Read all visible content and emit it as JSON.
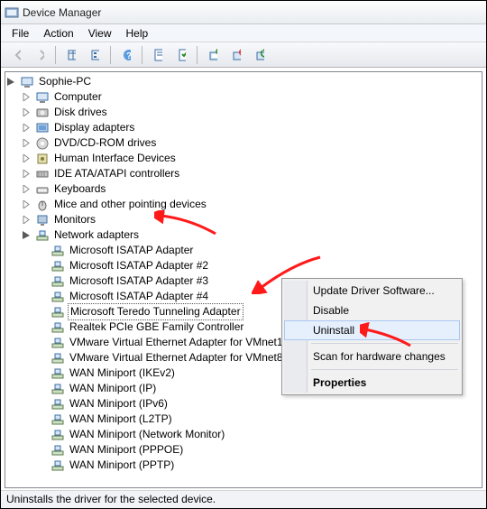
{
  "window": {
    "title": "Device Manager"
  },
  "menu": {
    "file": "File",
    "action": "Action",
    "view": "View",
    "help": "Help"
  },
  "tree": {
    "root": "Sophie-PC",
    "nodes": [
      {
        "label": "Computer"
      },
      {
        "label": "Disk drives"
      },
      {
        "label": "Display adapters"
      },
      {
        "label": "DVD/CD-ROM drives"
      },
      {
        "label": "Human Interface Devices"
      },
      {
        "label": "IDE ATA/ATAPI controllers"
      },
      {
        "label": "Keyboards"
      },
      {
        "label": "Mice and other pointing devices"
      },
      {
        "label": "Monitors"
      }
    ],
    "network": {
      "label": "Network adapters",
      "children": [
        "Microsoft ISATAP Adapter",
        "Microsoft ISATAP Adapter #2",
        "Microsoft ISATAP Adapter #3",
        "Microsoft ISATAP Adapter #4",
        "Microsoft Teredo Tunneling Adapter",
        "Realtek PCIe GBE Family Controller",
        "VMware Virtual Ethernet Adapter for VMnet1",
        "VMware Virtual Ethernet Adapter for VMnet8",
        "WAN Miniport (IKEv2)",
        "WAN Miniport (IP)",
        "WAN Miniport (IPv6)",
        "WAN Miniport (L2TP)",
        "WAN Miniport (Network Monitor)",
        "WAN Miniport (PPPOE)",
        "WAN Miniport (PPTP)"
      ],
      "selected_index": 4
    }
  },
  "context_menu": {
    "update": "Update Driver Software...",
    "disable": "Disable",
    "uninstall": "Uninstall",
    "scan": "Scan for hardware changes",
    "properties": "Properties"
  },
  "status": "Uninstalls the driver for the selected device."
}
